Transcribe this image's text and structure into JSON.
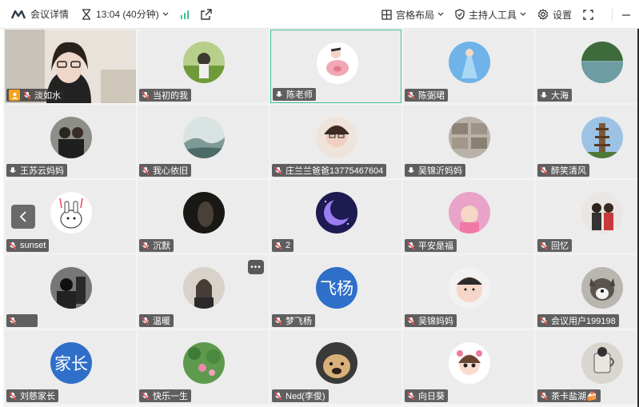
{
  "topbar": {
    "meeting_details": "会议详情",
    "time_display": "13:04 (40分钟)",
    "layout_label": "宫格布局",
    "host_tools_label": "主持人工具",
    "settings_label": "设置"
  },
  "participants": [
    {
      "name": "淡如水",
      "role": "host",
      "mic": "muted",
      "avatar": "video"
    },
    {
      "name": "当初的我",
      "mic": "muted",
      "avatar": "photo-field"
    },
    {
      "name": "陈老师",
      "mic": "on",
      "avatar": "cartoon-pig",
      "speaking": true
    },
    {
      "name": "陈弼珺",
      "mic": "muted",
      "avatar": "photo-blue"
    },
    {
      "name": "大海",
      "mic": "on",
      "avatar": "photo-lake"
    },
    {
      "name": "王苏云妈妈",
      "mic": "on",
      "avatar": "photo-friends"
    },
    {
      "name": "我心依旧",
      "mic": "muted",
      "avatar": "photo-mist"
    },
    {
      "name": "庄兰兰爸爸13775467604",
      "mic": "muted",
      "avatar": "photo-girl"
    },
    {
      "name": "吴锦沂妈妈",
      "mic": "on",
      "avatar": "photo-boxes"
    },
    {
      "name": "醉笑清风",
      "mic": "muted",
      "avatar": "photo-pagoda"
    },
    {
      "name": "sunset",
      "mic": "muted",
      "avatar": "cartoon-rabbit"
    },
    {
      "name": "沉默",
      "mic": "muted",
      "avatar": "photo-dark"
    },
    {
      "name": "2",
      "mic": "muted",
      "avatar": "moon"
    },
    {
      "name": "平安是福",
      "mic": "muted",
      "avatar": "photo-baby"
    },
    {
      "name": "回忆",
      "mic": "muted",
      "avatar": "photo-couple"
    },
    {
      "name": "",
      "mic": "muted",
      "avatar": "photo-bw"
    },
    {
      "name": "温暖",
      "mic": "muted",
      "avatar": "photo-woman"
    },
    {
      "name": "梦飞杨",
      "mic": "muted",
      "avatar": "text",
      "avatar_text": "飞杨",
      "avatar_color": "#2f6fc9"
    },
    {
      "name": "吴锦妈妈",
      "mic": "muted",
      "avatar": "photo-infant"
    },
    {
      "name": "会议用户199198",
      "mic": "muted",
      "avatar": "photo-dog"
    },
    {
      "name": "刘慈家长",
      "mic": "muted",
      "avatar": "text",
      "avatar_text": "家长",
      "avatar_color": "#2f6fc9"
    },
    {
      "name": "快乐一生",
      "mic": "muted",
      "avatar": "photo-lotus"
    },
    {
      "name": "Ned(李俊)",
      "mic": "muted",
      "avatar": "photo-puppy"
    },
    {
      "name": "向日葵",
      "mic": "muted",
      "avatar": "cartoon-girl"
    },
    {
      "name": "茶卡盐湖🍰",
      "mic": "muted",
      "avatar": "photo-cup"
    }
  ],
  "colors": {
    "speaking_border": "#3cc38e",
    "host_badge": "#f7a21b",
    "text_avatar": "#2f6fc9"
  }
}
